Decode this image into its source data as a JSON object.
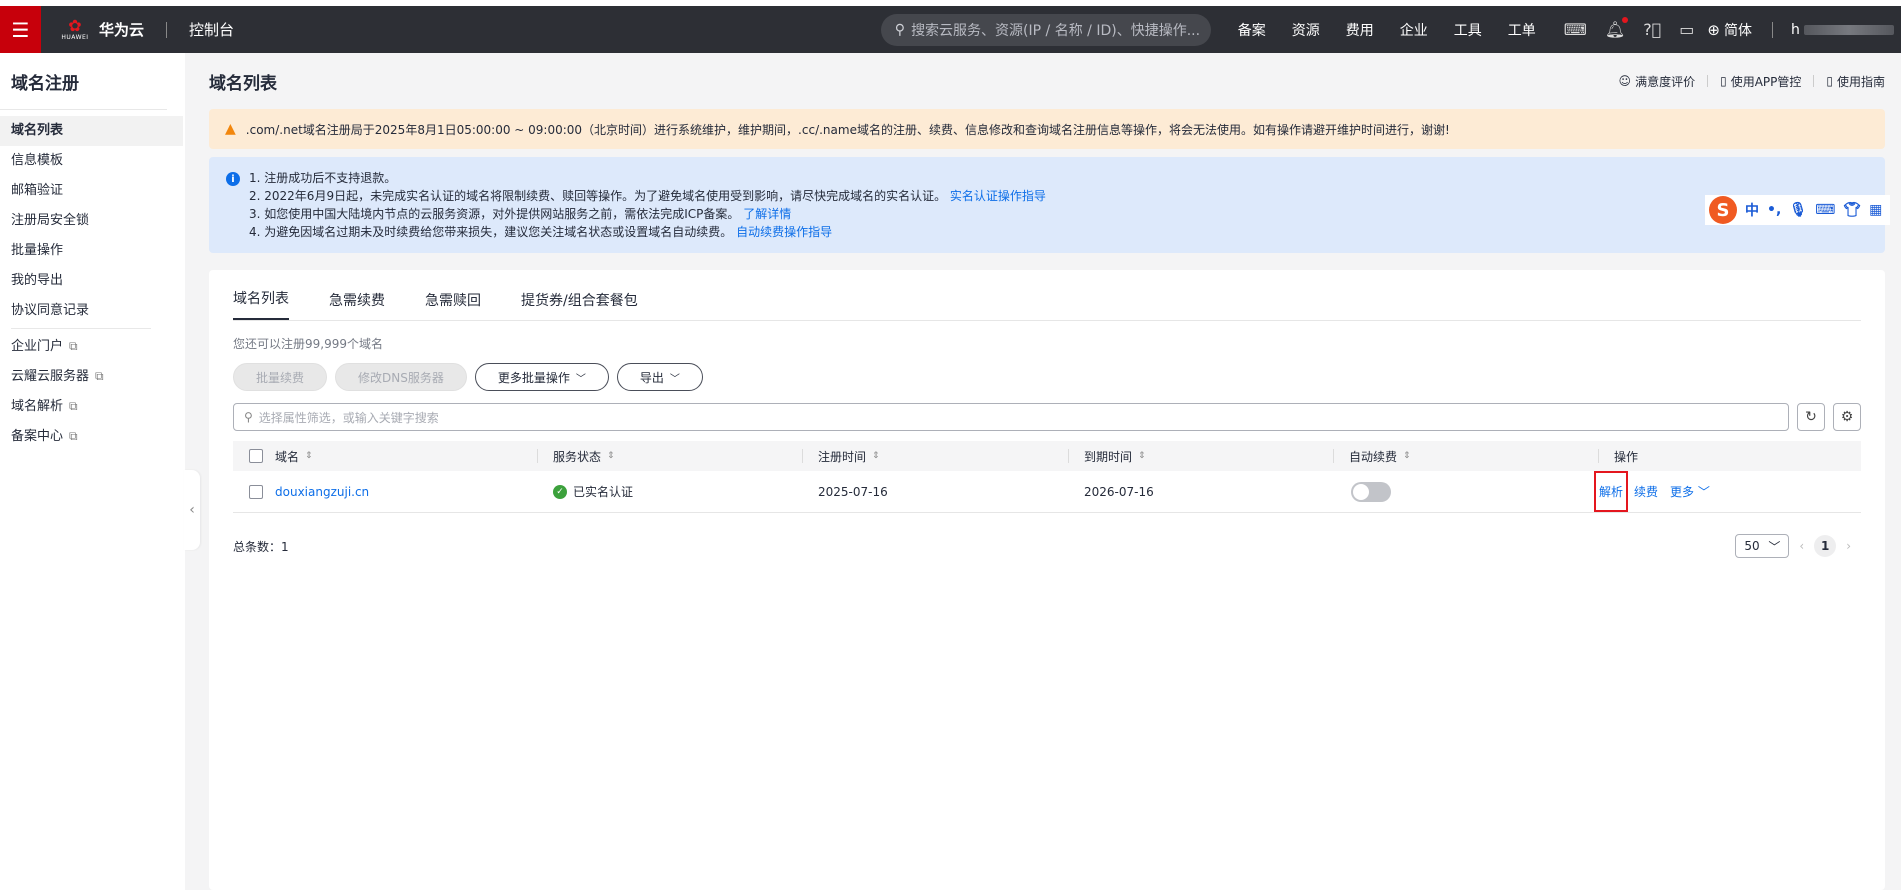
{
  "topbar": {
    "logo_text": "华为云",
    "logo_sub": "HUAWEI",
    "console": "控制台",
    "search_placeholder": "搜索云服务、资源(IP / 名称 / ID)、快捷操作...",
    "nav": [
      "备案",
      "资源",
      "费用",
      "企业",
      "工具",
      "工单"
    ],
    "lang": "简体",
    "account": "h"
  },
  "sidebar": {
    "title": "域名注册",
    "items": [
      "域名列表",
      "信息模板",
      "邮箱验证",
      "注册局安全锁",
      "批量操作",
      "我的导出",
      "协议同意记录"
    ],
    "ext_items": [
      "企业门户",
      "云耀云服务器",
      "域名解析",
      "备案中心"
    ]
  },
  "header": {
    "title": "域名列表",
    "links": [
      "满意度评价",
      "使用APP管控",
      "使用指南"
    ]
  },
  "warning": ".com/.net域名注册局于2025年8月1日05:00:00 ~ 09:00:00（北京时间）进行系统维护，维护期间，.cc/.name域名的注册、续费、信息修改和查询域名注册信息等操作，将会无法使用。如有操作请避开维护时间进行，谢谢!",
  "info": {
    "line1": "1. 注册成功后不支持退款。",
    "line2": "2. 2022年6月9日起，未完成实名认证的域名将限制续费、赎回等操作。为了避免域名使用受到影响，请尽快完成域名的实名认证。",
    "line2_link": "实名认证操作指导",
    "line3": "3. 如您使用中国大陆境内节点的云服务资源，对外提供网站服务之前，需依法完成ICP备案。",
    "line3_link": "了解详情",
    "line4": "4. 为避免因域名过期未及时续费给您带来损失，建议您关注域名状态或设置域名自动续费。",
    "line4_link": "自动续费操作指导"
  },
  "ime": {
    "mode": "中",
    "punct": "•,"
  },
  "tabs": [
    "域名列表",
    "急需续费",
    "急需赎回",
    "提货券/组合套餐包"
  ],
  "quota": "您还可以注册99,999个域名",
  "buttons": {
    "batch_renew": "批量续费",
    "modify_dns": "修改DNS服务器",
    "more_batch": "更多批量操作",
    "export": "导出"
  },
  "filter_placeholder": "选择属性筛选，或输入关键字搜索",
  "table": {
    "headers": [
      "域名",
      "服务状态",
      "注册时间",
      "到期时间",
      "自动续费",
      "操作"
    ],
    "rows": [
      {
        "domain": "douxiangzuji.cn",
        "status": "已实名认证",
        "reg_date": "2025-07-16",
        "exp_date": "2026-07-16",
        "auto_renew": false,
        "ops": [
          "解析",
          "续费",
          "更多"
        ]
      }
    ]
  },
  "footer": {
    "total": "总条数：1",
    "page_size": "50",
    "current_page": "1"
  },
  "colors": {
    "brand": "#c7000b",
    "topbar": "#2d2f35",
    "link": "#0d6ee8",
    "warn_bg": "#fdebd5",
    "info_bg": "#dde9fb",
    "highlight": "#e4161e"
  }
}
